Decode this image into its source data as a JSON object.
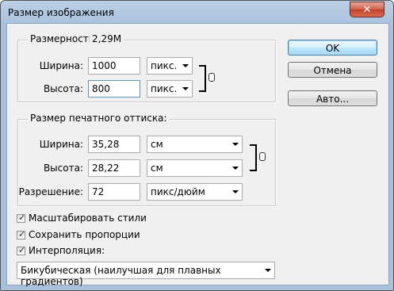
{
  "window": {
    "title": "Размер изображения",
    "close_glyph": "✕"
  },
  "pixel_dims": {
    "label": "Размерность:",
    "size": "2,29M",
    "width": {
      "label": "Ширина:",
      "value": "1000",
      "unit": "пикс."
    },
    "height": {
      "label": "Высота:",
      "value": "800",
      "unit": "пикс."
    }
  },
  "print_size": {
    "label": "Размер печатного оттиска:",
    "width": {
      "label": "Ширина:",
      "value": "35,28",
      "unit": "см"
    },
    "height": {
      "label": "Высота:",
      "value": "28,22",
      "unit": "см"
    },
    "resolution": {
      "label": "Разрешение:",
      "value": "72",
      "unit": "пикс/дюйм"
    }
  },
  "options": {
    "scale_styles": {
      "label": "Масштабировать стили",
      "checked": true
    },
    "constrain": {
      "label": "Сохранить пропорции",
      "checked": true
    },
    "resample": {
      "label": "Интерполяция:",
      "checked": true
    },
    "resample_method": "Бикубическая (наилучшая для плавных градиентов)"
  },
  "buttons": {
    "ok": "OK",
    "cancel": "Отмена",
    "auto": "Авто..."
  },
  "colors": {
    "accent": "#3c7fb1",
    "title_bar": "#a9c1dc",
    "close": "#c0412b"
  }
}
